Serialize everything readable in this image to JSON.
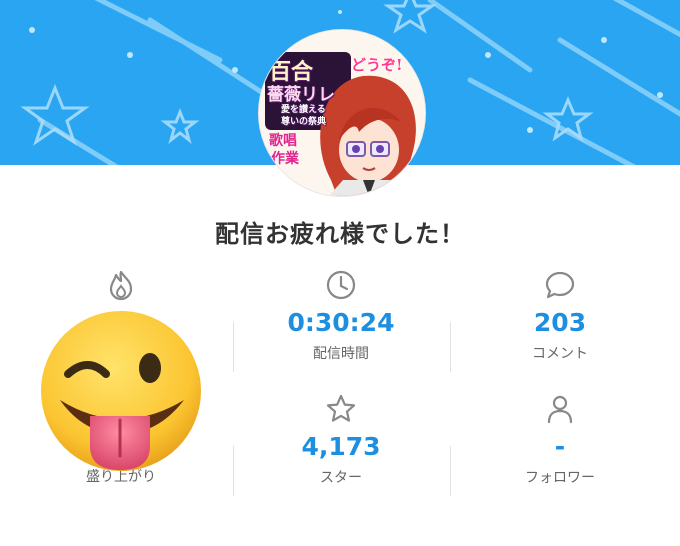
{
  "banner": {
    "color": "#2aa5f2"
  },
  "avatar": {
    "line1": "百合",
    "line2": "薔薇リレ",
    "line3": "愛を讃える",
    "line4": "尊いの祭典",
    "badge": "どうぞ!",
    "side1": "歌唱",
    "side2": "作業"
  },
  "title": "配信お疲れ様でした！",
  "stats": [
    {
      "icon": "fire-icon",
      "value": "",
      "label": "盛り上がり"
    },
    {
      "icon": "clock-icon",
      "value": "0:30:24",
      "label": "配信時間"
    },
    {
      "icon": "comment-icon",
      "value": "203",
      "label": "コメント"
    },
    {
      "icon": "star-icon",
      "value": "4,173",
      "label": "スター"
    },
    {
      "icon": "person-icon",
      "value": "-",
      "label": "フォロワー"
    }
  ],
  "colors": {
    "accent": "#1d8fe0",
    "icon": "#888888",
    "label": "#666666"
  },
  "sticker": "winking-tongue-emoji"
}
